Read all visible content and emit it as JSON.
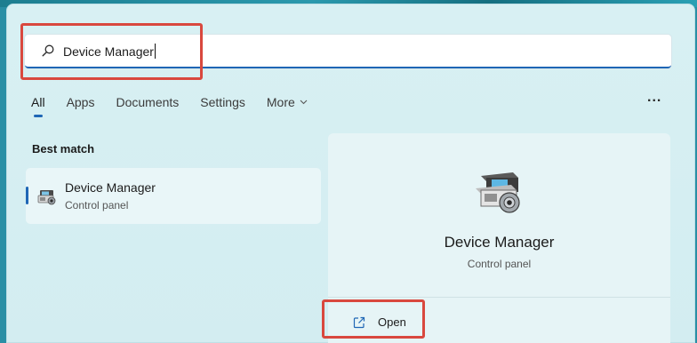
{
  "search": {
    "query": "Device Manager"
  },
  "tabs": [
    {
      "label": "All",
      "active": true
    },
    {
      "label": "Apps"
    },
    {
      "label": "Documents"
    },
    {
      "label": "Settings"
    },
    {
      "label": "More"
    }
  ],
  "more_options_label": "...",
  "best_match": {
    "heading": "Best match",
    "item": {
      "title": "Device Manager",
      "subtitle": "Control panel",
      "icon": "device-manager-icon"
    }
  },
  "preview": {
    "title": "Device Manager",
    "subtitle": "Control panel",
    "icon": "device-manager-icon",
    "actions": [
      {
        "label": "Open",
        "icon": "open-external-icon"
      }
    ]
  },
  "colors": {
    "accent": "#1f66b5",
    "highlight": "#d9483e",
    "panel_bg": "#d8f0f3"
  }
}
